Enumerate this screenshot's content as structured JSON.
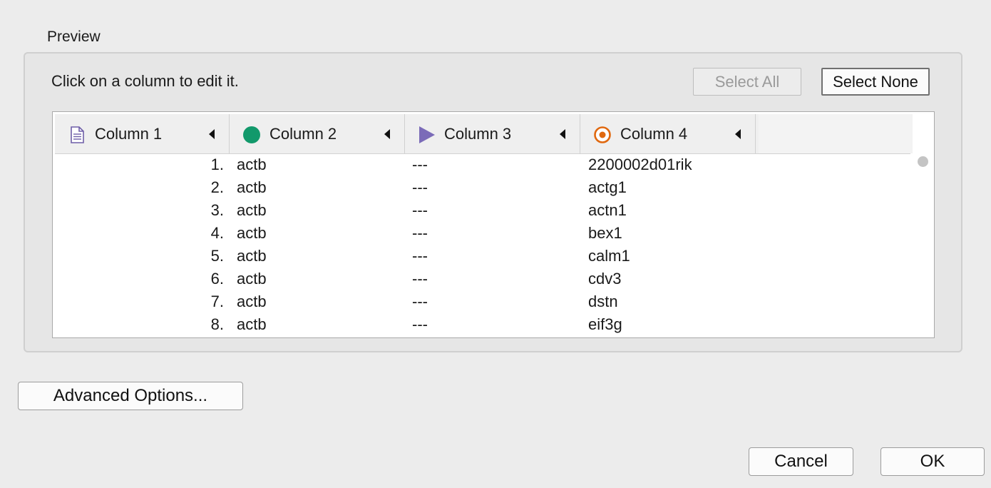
{
  "preview": {
    "label": "Preview",
    "instruction": "Click on a column to edit it.",
    "select_all_label": "Select All",
    "select_none_label": "Select None"
  },
  "columns": [
    {
      "label": "Column 1",
      "icon": "document-icon",
      "color": "#6f5fa8"
    },
    {
      "label": "Column 2",
      "icon": "green-circle-icon",
      "color": "#12996b"
    },
    {
      "label": "Column 3",
      "icon": "purple-triangle-icon",
      "color": "#7b6bb8"
    },
    {
      "label": "Column 4",
      "icon": "target-icon",
      "color": "#e0680f"
    }
  ],
  "rows": [
    {
      "num": "1.",
      "c2": "actb",
      "c3": "---",
      "c4": "2200002d01rik"
    },
    {
      "num": "2.",
      "c2": "actb",
      "c3": "---",
      "c4": "actg1"
    },
    {
      "num": "3.",
      "c2": "actb",
      "c3": "---",
      "c4": "actn1"
    },
    {
      "num": "4.",
      "c2": "actb",
      "c3": "---",
      "c4": "bex1"
    },
    {
      "num": "5.",
      "c2": "actb",
      "c3": "---",
      "c4": "calm1"
    },
    {
      "num": "6.",
      "c2": "actb",
      "c3": "---",
      "c4": "cdv3"
    },
    {
      "num": "7.",
      "c2": "actb",
      "c3": "---",
      "c4": "dstn"
    },
    {
      "num": "8.",
      "c2": "actb",
      "c3": "---",
      "c4": "eif3g"
    }
  ],
  "footer": {
    "advanced_label": "Advanced Options...",
    "cancel_label": "Cancel",
    "ok_label": "OK"
  }
}
